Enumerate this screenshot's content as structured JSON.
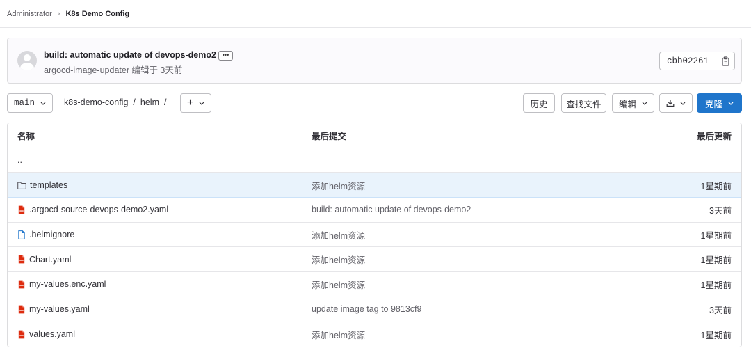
{
  "breadcrumb": {
    "root": "Administrator",
    "separator": "›",
    "current": "K8s Demo Config"
  },
  "commit": {
    "title": "build: automatic update of devops-demo2",
    "ellipsis": "•••",
    "meta": "argocd-image-updater 编辑于 3天前",
    "sha": "cbb02261"
  },
  "toolbar": {
    "branch": "main",
    "path": [
      "k8s-demo-config",
      "helm"
    ],
    "path_separator": "/",
    "add_label": "+",
    "history_label": "历史",
    "find_label": "查找文件",
    "edit_label": "编辑",
    "clone_label": "克隆"
  },
  "table": {
    "headers": {
      "name": "名称",
      "commit": "最后提交",
      "date": "最后更新"
    },
    "parent": "..",
    "rows": [
      {
        "name": "templates",
        "type": "folder",
        "commit": "添加helm资源",
        "date": "1星期前"
      },
      {
        "name": ".argocd-source-devops-demo2.yaml",
        "type": "yaml",
        "commit": "build: automatic update of devops-demo2",
        "date": "3天前"
      },
      {
        "name": ".helmignore",
        "type": "file",
        "commit": "添加helm资源",
        "date": "1星期前"
      },
      {
        "name": "Chart.yaml",
        "type": "yaml",
        "commit": "添加helm资源",
        "date": "1星期前"
      },
      {
        "name": "my-values.enc.yaml",
        "type": "yaml",
        "commit": "添加helm资源",
        "date": "1星期前"
      },
      {
        "name": "my-values.yaml",
        "type": "yaml",
        "commit": "update image tag to 9813cf9",
        "date": "3天前"
      },
      {
        "name": "values.yaml",
        "type": "yaml",
        "commit": "添加helm资源",
        "date": "1星期前"
      }
    ]
  },
  "colors": {
    "accent": "#1f75cb",
    "yaml_icon": "#dd2b0e",
    "file_icon": "#1f75cb",
    "highlight_row": "#e9f3fc"
  }
}
